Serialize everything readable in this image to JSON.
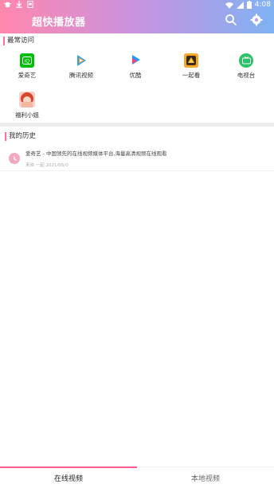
{
  "status_bar": {
    "left_icons": [
      "bug-icon",
      "download-icon",
      "note-icon"
    ],
    "right_icons": [
      "wifi-icon",
      "signal-icon",
      "battery-icon"
    ],
    "time": "4:08"
  },
  "header": {
    "title": "超快播放器",
    "search_icon": "search-icon",
    "settings_icon": "settings-icon"
  },
  "frequent": {
    "label": "最常访问",
    "sites": [
      {
        "label": "爱奇艺",
        "icon": "iqiyi-icon",
        "color": "#00be06"
      },
      {
        "label": "腾讯视频",
        "icon": "tencent-video-icon",
        "color": "#20a4f3"
      },
      {
        "label": "优酷",
        "icon": "youku-icon",
        "color": "#1f9df7"
      },
      {
        "label": "一起看",
        "icon": "watch-together-icon",
        "color": "#f5a623"
      },
      {
        "label": "电视台",
        "icon": "tv-station-icon",
        "color": "#2bc26a"
      },
      {
        "label": "福利小姐",
        "icon": "welfare-icon",
        "color": "#f2b8a0"
      }
    ]
  },
  "history": {
    "label": "我的历史",
    "items": [
      {
        "title": "爱奇艺 - 中国领先的在线视频媒体平台,海量高清视频在线观看",
        "meta": "来自 一起 2021/05/0"
      }
    ]
  },
  "tabs": {
    "online": "在线视频",
    "local": "本地视频"
  }
}
